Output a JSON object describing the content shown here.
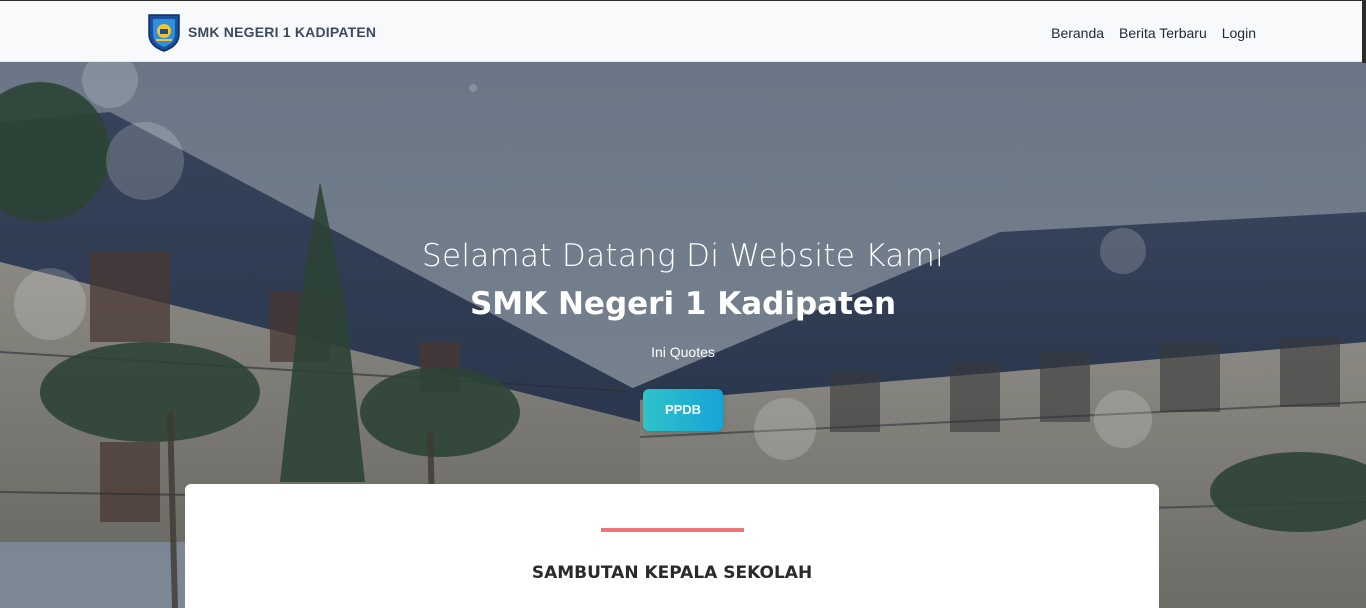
{
  "navbar": {
    "brand": "SMK NEGERI 1 KADIPATEN",
    "links": [
      "Beranda",
      "Berita Terbaru",
      "Login"
    ]
  },
  "hero": {
    "welcome": "Selamat Datang Di Website Kami",
    "title": "SMK Negeri 1 Kadipaten",
    "quote": "Ini Quotes",
    "button": "PPDB"
  },
  "section": {
    "title": "SAMBUTAN KEPALA SEKOLAH"
  },
  "colors": {
    "accent": "#ef7478",
    "button_start": "#2ec4c9",
    "button_end": "#16a3d6",
    "navbar_bg": "#f8f9fb"
  },
  "icons": {
    "logo": "school-shield-logo"
  }
}
